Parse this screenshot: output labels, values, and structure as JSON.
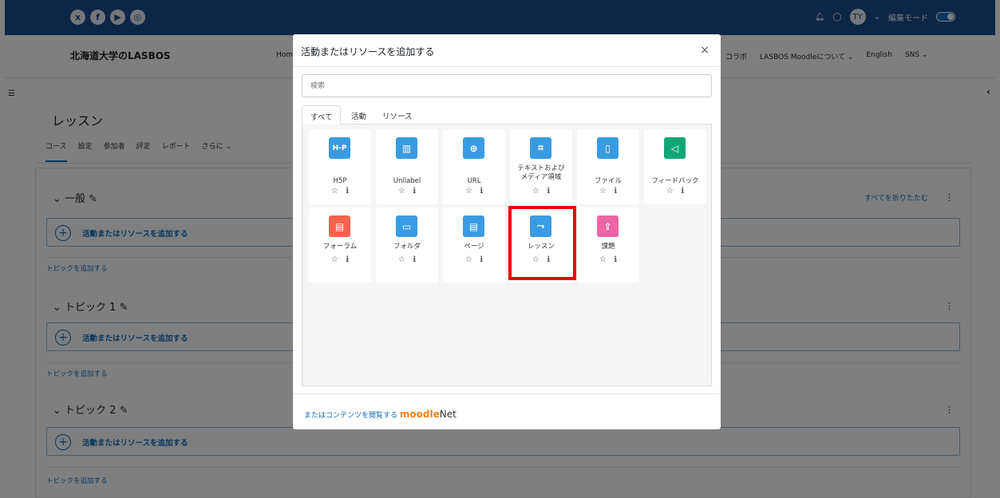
{
  "topbar": {
    "social": [
      "x",
      "f",
      "▶",
      "◎"
    ],
    "user_initials": "TY",
    "edit_mode_label": "編集モード"
  },
  "navbar": {
    "brand": "北海道大学のLASBOS",
    "home_partial": "Hom",
    "items": [
      "コラボ",
      "LASBOS Moodleについて ⌄",
      "English",
      "SNS ⌄"
    ]
  },
  "page": {
    "title": "レッスン",
    "secondary_nav": [
      "コース",
      "設定",
      "参加者",
      "評定",
      "レポート",
      "さらに ⌄"
    ],
    "collapse_all": "すべてを折りたたむ",
    "sections": [
      {
        "name": "一般",
        "add_label": "活動またはリソースを追加する",
        "add_topic": "トピックを追加する"
      },
      {
        "name": "トピック 1",
        "add_label": "活動またはリソースを追加する",
        "add_topic": "トピックを追加する"
      },
      {
        "name": "トピック 2",
        "add_label": "活動またはリソースを追加する",
        "add_topic": "トピックを追加する"
      }
    ]
  },
  "modal": {
    "title": "活動またはリソースを追加する",
    "search_placeholder": "検索",
    "tabs": [
      "すべて",
      "活動",
      "リソース"
    ],
    "tiles": [
      {
        "name": "H5P",
        "icon": "H-P",
        "color": "#399be2"
      },
      {
        "name": "Unilabel",
        "icon": "▥",
        "color": "#399be2"
      },
      {
        "name": "URL",
        "icon": "⊕",
        "color": "#399be2"
      },
      {
        "name": "テキストおよび メディア領域",
        "icon": "⌗",
        "color": "#399be2"
      },
      {
        "name": "ファイル",
        "icon": "▯",
        "color": "#399be2"
      },
      {
        "name": "フィードバック",
        "icon": "◁",
        "color": "#11a676"
      },
      {
        "name": "フォーラム",
        "icon": "▤",
        "color": "#f7634d"
      },
      {
        "name": "フォルダ",
        "icon": "▭",
        "color": "#399be2"
      },
      {
        "name": "ページ",
        "icon": "▤",
        "color": "#399be2"
      },
      {
        "name": "レッスン",
        "icon": "⤳",
        "color": "#399be2"
      },
      {
        "name": "課題",
        "icon": "⇪",
        "color": "#eb66a2"
      }
    ],
    "footer_text": "またはコンテンツを閲覧する",
    "footer_brand_a": "moodle",
    "footer_brand_b": "Net"
  }
}
